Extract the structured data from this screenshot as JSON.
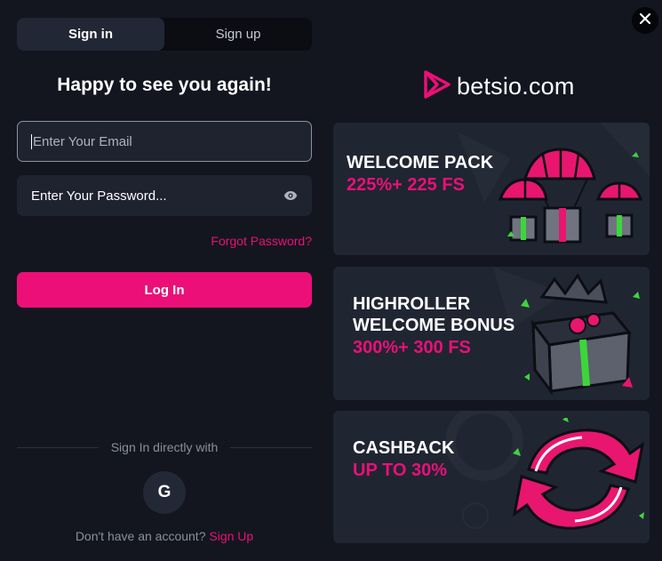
{
  "tabs": {
    "signin": "Sign in",
    "signup": "Sign up"
  },
  "heading": "Happy to see you again!",
  "form": {
    "email_placeholder": "Enter Your Email",
    "password_placeholder": "Enter Your Password...",
    "forgot": "Forgot Password?",
    "login": "Log In"
  },
  "social": {
    "label": "Sign In directly with",
    "google": "G"
  },
  "footer": {
    "prompt": "Don't have an account?",
    "link": "Sign Up"
  },
  "brand": {
    "name": "betsio.com"
  },
  "promos": [
    {
      "title": "WELCOME PACK",
      "subtitle": "225%+ 225 FS"
    },
    {
      "title_line1": "HIGHROLLER",
      "title_line2": "WELCOME BONUS",
      "subtitle": "300%+ 300 FS"
    },
    {
      "title": "CASHBACK",
      "subtitle": "UP TO 30%"
    }
  ],
  "colors": {
    "accent": "#ec0f77",
    "background": "#13161f",
    "panel": "#202532",
    "green": "#3cd63c"
  },
  "icons": [
    "eye-icon",
    "google-icon",
    "close-icon",
    "logo-icon"
  ]
}
